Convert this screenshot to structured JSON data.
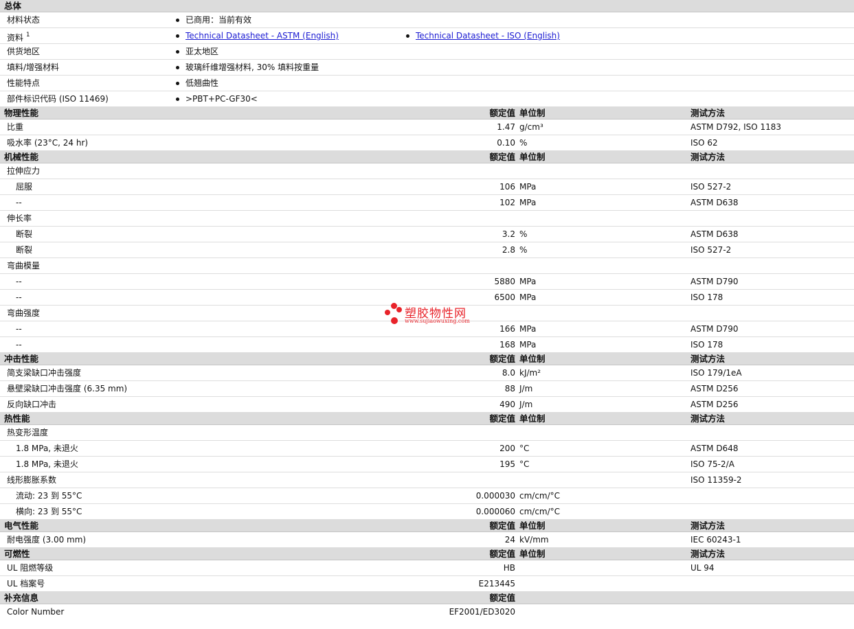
{
  "general": {
    "title": "总体",
    "material_status": {
      "label": "材料状态",
      "value": "已商用：当前有效"
    },
    "documents": {
      "label": "资料",
      "note": "1",
      "links": [
        "Technical Datasheet - ASTM (English)",
        "Technical Datasheet - ISO (English)"
      ]
    },
    "region": {
      "label": "供货地区",
      "value": "亚太地区"
    },
    "filler": {
      "label": "填料/增强材料",
      "value": "玻璃纤维增强材料, 30% 填料按重量"
    },
    "features": {
      "label": "性能特点",
      "value": "低翘曲性"
    },
    "part_code": {
      "label": "部件标识代码 (ISO 11469)",
      "value": ">PBT+PC-GF30<"
    }
  },
  "sections": [
    {
      "title": "物理性能",
      "col_value": "额定值",
      "col_unit": "单位制",
      "col_method": "测试方法",
      "rows": [
        {
          "label": "比重",
          "value": "1.47",
          "unit": "g/cm³",
          "method": "ASTM D792, ISO 1183"
        },
        {
          "label": "吸水率 (23°C, 24 hr)",
          "value": "0.10",
          "unit": "%",
          "method": "ISO 62"
        }
      ]
    },
    {
      "title": "机械性能",
      "col_value": "额定值",
      "col_unit": "单位制",
      "col_method": "测试方法",
      "rows": [
        {
          "label": "拉伸应力",
          "value": "",
          "unit": "",
          "method": ""
        },
        {
          "label": "屈服",
          "sub": true,
          "value": "106",
          "unit": "MPa",
          "method": "ISO 527-2"
        },
        {
          "label": "--",
          "sub": true,
          "value": "102",
          "unit": "MPa",
          "method": "ASTM D638"
        },
        {
          "label": "伸长率",
          "value": "",
          "unit": "",
          "method": ""
        },
        {
          "label": "断裂",
          "sub": true,
          "value": "3.2",
          "unit": "%",
          "method": "ASTM D638"
        },
        {
          "label": "断裂",
          "sub": true,
          "value": "2.8",
          "unit": "%",
          "method": "ISO 527-2"
        },
        {
          "label": "弯曲模量",
          "value": "",
          "unit": "",
          "method": ""
        },
        {
          "label": "--",
          "sub": true,
          "value": "5880",
          "unit": "MPa",
          "method": "ASTM D790"
        },
        {
          "label": "--",
          "sub": true,
          "value": "6500",
          "unit": "MPa",
          "method": "ISO 178"
        },
        {
          "label": "弯曲强度",
          "value": "",
          "unit": "",
          "method": ""
        },
        {
          "label": "--",
          "sub": true,
          "value": "166",
          "unit": "MPa",
          "method": "ASTM D790"
        },
        {
          "label": "--",
          "sub": true,
          "value": "168",
          "unit": "MPa",
          "method": "ISO 178"
        }
      ]
    },
    {
      "title": "冲击性能",
      "col_value": "额定值",
      "col_unit": "单位制",
      "col_method": "测试方法",
      "rows": [
        {
          "label": "简支梁缺口冲击强度",
          "value": "8.0",
          "unit": "kJ/m²",
          "method": "ISO 179/1eA"
        },
        {
          "label": "悬壁梁缺口冲击强度 (6.35 mm)",
          "value": "88",
          "unit": "J/m",
          "method": "ASTM D256"
        },
        {
          "label": "反向缺口冲击",
          "value": "490",
          "unit": "J/m",
          "method": "ASTM D256"
        }
      ]
    },
    {
      "title": "热性能",
      "col_value": "额定值",
      "col_unit": "单位制",
      "col_method": "测试方法",
      "rows": [
        {
          "label": "热变形温度",
          "value": "",
          "unit": "",
          "method": ""
        },
        {
          "label": "1.8 MPa, 未退火",
          "sub": true,
          "value": "200",
          "unit": "°C",
          "method": "ASTM D648"
        },
        {
          "label": "1.8 MPa, 未退火",
          "sub": true,
          "value": "195",
          "unit": "°C",
          "method": "ISO 75-2/A"
        },
        {
          "label": "线形膨胀系数",
          "value": "",
          "unit": "",
          "method": "ISO 11359-2"
        },
        {
          "label": "流动: 23 到 55°C",
          "sub": true,
          "value": "0.000030",
          "unit": "cm/cm/°C",
          "method": ""
        },
        {
          "label": "横向: 23 到 55°C",
          "sub": true,
          "value": "0.000060",
          "unit": "cm/cm/°C",
          "method": ""
        }
      ]
    },
    {
      "title": "电气性能",
      "col_value": "额定值",
      "col_unit": "单位制",
      "col_method": "测试方法",
      "rows": [
        {
          "label": "耐电强度 (3.00 mm)",
          "value": "24",
          "unit": "kV/mm",
          "method": "IEC 60243-1"
        }
      ]
    },
    {
      "title": "可燃性",
      "col_value": "额定值",
      "col_unit": "单位制",
      "col_method": "测试方法",
      "rows": [
        {
          "label": "UL 阻燃等级",
          "value": "HB",
          "unit": "",
          "method": "UL 94"
        },
        {
          "label": "UL 档案号",
          "value": "E213445",
          "unit": "",
          "method": ""
        }
      ]
    },
    {
      "title": "补充信息",
      "col_value": "额定值",
      "col_unit": "",
      "col_method": "",
      "rows": [
        {
          "label": "Color Number",
          "value": "EF2001/ED3020",
          "unit": "",
          "method": ""
        }
      ]
    }
  ],
  "watermark": {
    "text": "塑胶物性网",
    "url": "www.sujiaowuxing.com",
    "color": "#e8232a"
  }
}
